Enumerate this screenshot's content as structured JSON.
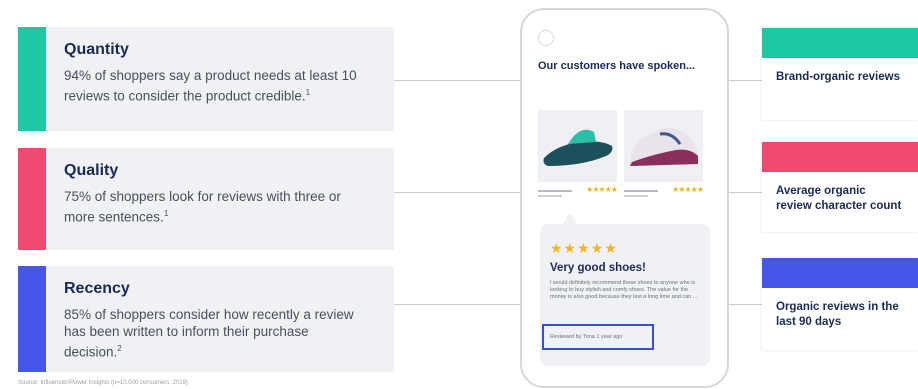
{
  "cards": [
    {
      "title": "Quantity",
      "body": "94% of shoppers say a product needs at least 10 reviews to consider the product credible.",
      "sup": "1",
      "color": "#1ec8a5"
    },
    {
      "title": "Quality",
      "body": "75% of shoppers look for reviews with three or more sentences.",
      "sup": "1",
      "color": "#f2496f"
    },
    {
      "title": "Recency",
      "body": "85% of shoppers consider how recently a review has been written to inform their purchase decision.",
      "sup": "2",
      "color": "#4457e8"
    }
  ],
  "phone": {
    "heading": "Our customers have spoken...",
    "product_stars": "★★★★★",
    "review": {
      "stars": "★★★★★",
      "title": "Very good shoes!",
      "body": "I would definitely recommend these shoes to anyone who is looking to buy stylish and comfy shoes. The value for the money is also good because they last a long time and can ...",
      "reviewed": "Reviewed by Tona 1 year ago"
    }
  },
  "right_cards": [
    {
      "label": "Brand-organic reviews",
      "color": "#1ec8a5"
    },
    {
      "label": "Average organic review character count",
      "color": "#f2496f"
    },
    {
      "label": "Organic reviews in the last 90 days",
      "color": "#4457e8"
    }
  ],
  "footnote": "Source: Influenster/Power Insights (n=10,000 consumers, 2019)"
}
